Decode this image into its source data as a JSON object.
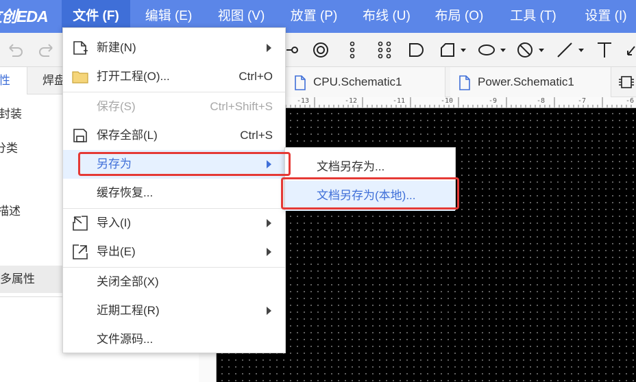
{
  "app": {
    "logo": "立创EDA"
  },
  "menubar": {
    "items": [
      {
        "label": "文件 (F)"
      },
      {
        "label": "编辑 (E)"
      },
      {
        "label": "视图 (V)"
      },
      {
        "label": "放置 (P)"
      },
      {
        "label": "布线 (U)"
      },
      {
        "label": "布局 (O)"
      },
      {
        "label": "工具 (T)"
      },
      {
        "label": "设置 (I)"
      }
    ]
  },
  "left_panel": {
    "tabs": [
      {
        "label": "性"
      },
      {
        "label": "焊盘"
      }
    ],
    "rows": [
      {
        "label": "封装"
      },
      {
        "label": "分类"
      },
      {
        "label": "描述"
      }
    ],
    "more_props": "多属性"
  },
  "doc_tabs": [
    {
      "label": "CPU.Schematic1"
    },
    {
      "label": "Power.Schematic1"
    }
  ],
  "ruler": {
    "ticks": [
      "-13",
      "-12",
      "-11",
      "-10",
      "-9",
      "-8",
      "-7",
      "-6"
    ]
  },
  "file_menu": {
    "items": [
      {
        "label": "新建(N)",
        "shortcut": "",
        "icon": "new-file-icon",
        "submenu": true,
        "disabled": false
      },
      {
        "label": "打开工程(O)...",
        "shortcut": "Ctrl+O",
        "icon": "folder-icon",
        "submenu": false,
        "disabled": false
      },
      {
        "label": "保存(S)",
        "shortcut": "Ctrl+Shift+S",
        "icon": "",
        "submenu": false,
        "disabled": true
      },
      {
        "label": "保存全部(L)",
        "shortcut": "Ctrl+S",
        "icon": "save-icon",
        "submenu": false,
        "disabled": false
      },
      {
        "label": "另存为",
        "shortcut": "",
        "icon": "",
        "submenu": true,
        "disabled": false
      },
      {
        "label": "缓存恢复...",
        "shortcut": "",
        "icon": "",
        "submenu": false,
        "disabled": false
      },
      {
        "label": "导入(I)",
        "shortcut": "",
        "icon": "import-icon",
        "submenu": true,
        "disabled": false
      },
      {
        "label": "导出(E)",
        "shortcut": "",
        "icon": "export-icon",
        "submenu": true,
        "disabled": false
      },
      {
        "label": "关闭全部(X)",
        "shortcut": "",
        "icon": "",
        "submenu": false,
        "disabled": false
      },
      {
        "label": "近期工程(R)",
        "shortcut": "",
        "icon": "",
        "submenu": true,
        "disabled": false
      },
      {
        "label": "文件源码...",
        "shortcut": "",
        "icon": "",
        "submenu": false,
        "disabled": false
      }
    ]
  },
  "save_as_submenu": {
    "items": [
      {
        "label": "文档另存为..."
      },
      {
        "label": "文档另存为(本地)..."
      }
    ]
  },
  "colors": {
    "menubar_bg": "#5b86e8",
    "menubar_active": "#3f6fd8",
    "highlight_bg": "#e6f1ff",
    "highlight_text": "#3f6fd8",
    "annotation_red": "#e53935",
    "canvas_bg": "#000000"
  }
}
